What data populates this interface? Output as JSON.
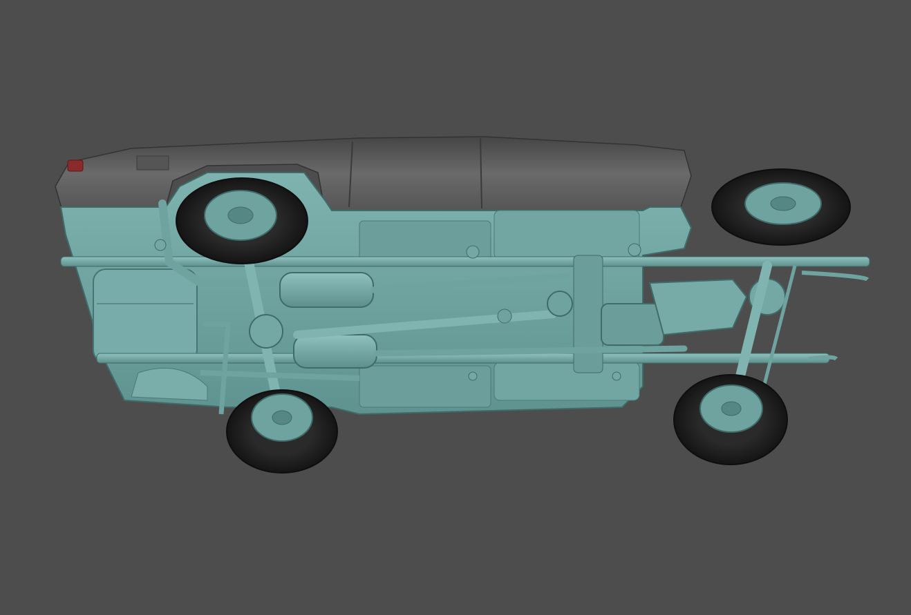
{
  "viewport": {
    "background_color": "#4d4d4d"
  },
  "model": {
    "body_color": "#6fa3a0",
    "body_shadow_color": "#4f7f7c",
    "roof_color": "#5e5e5e",
    "tire_color": "#1e1e1e",
    "tail_light_color": "#8a2a2a"
  }
}
